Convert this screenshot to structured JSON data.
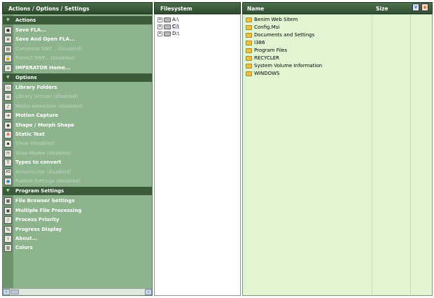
{
  "left_header": "Actions / Options / Settings",
  "filesystem_header": "Filesystem",
  "file_headers": {
    "name": "Name",
    "size": "Size"
  },
  "sections": [
    {
      "title": "Actions",
      "items": [
        {
          "label": "Save FLA...",
          "disabled": false,
          "icon": "circle-icon"
        },
        {
          "label": "Save And Open FLA...",
          "disabled": false,
          "icon": "save-open-icon"
        },
        {
          "label": "Compress SWF... (disabled)",
          "disabled": true,
          "icon": "compress-icon"
        },
        {
          "label": "Protect SWF... (disabled)",
          "disabled": true,
          "icon": "lock-icon"
        },
        {
          "label": "IMPERATOR Home...",
          "disabled": false,
          "icon": "home-icon"
        }
      ]
    },
    {
      "title": "Options",
      "items": [
        {
          "label": "Library Folders",
          "disabled": false,
          "icon": "folder-icon"
        },
        {
          "label": "Library Version (disabled)",
          "disabled": true,
          "icon": "library-icon"
        },
        {
          "label": "Media extraction (disabled)",
          "disabled": true,
          "icon": "media-icon"
        },
        {
          "label": "Motion Capture",
          "disabled": false,
          "icon": "motion-icon"
        },
        {
          "label": "Shape / Morph Shape",
          "disabled": false,
          "icon": "shape-icon"
        },
        {
          "label": "Static Text",
          "disabled": false,
          "icon": "text-icon"
        },
        {
          "label": "Show (disabled)",
          "disabled": true,
          "icon": "show-icon"
        },
        {
          "label": "Snap Modes (disabled)",
          "disabled": true,
          "icon": "snap-icon"
        },
        {
          "label": "Types to convert",
          "disabled": false,
          "icon": "types-icon"
        },
        {
          "label": "ActionScript (disabled)",
          "disabled": true,
          "icon": "actionscript-icon"
        },
        {
          "label": "Publish Settings (disabled)",
          "disabled": true,
          "icon": "globe-icon"
        }
      ]
    },
    {
      "title": "Program Settings",
      "items": [
        {
          "label": "File Browser Settings",
          "disabled": false,
          "icon": "browser-icon"
        },
        {
          "label": "Multiple File Processing",
          "disabled": false,
          "icon": "multi-file-icon"
        },
        {
          "label": "Process Priority",
          "disabled": false,
          "icon": "priority-icon"
        },
        {
          "label": "Progress Display",
          "disabled": false,
          "icon": "percent-icon"
        },
        {
          "label": "About...",
          "disabled": false,
          "icon": "about-icon"
        },
        {
          "label": "Colors",
          "disabled": false,
          "icon": "colors-icon"
        }
      ]
    }
  ],
  "drives": [
    {
      "label": "A:\\",
      "selected": false
    },
    {
      "label": "C:\\",
      "selected": true
    },
    {
      "label": "D:\\",
      "selected": false
    }
  ],
  "files": [
    "Benim Web Sitem",
    "Config.Msi",
    "Documents and Settings",
    "I386",
    "Program Files",
    "RECYCLER",
    "System Volume Information",
    "WINDOWS"
  ],
  "header_icons": [
    {
      "glyph": "V",
      "name": "view-icon",
      "color": "#4a6ab8"
    },
    {
      "glyph": "◉",
      "name": "firefox-icon",
      "color": "#e06020"
    }
  ],
  "colors": {
    "panel": "#8eb48e",
    "file_bg": "#e2f5d2",
    "header": "#3b5b3b"
  }
}
